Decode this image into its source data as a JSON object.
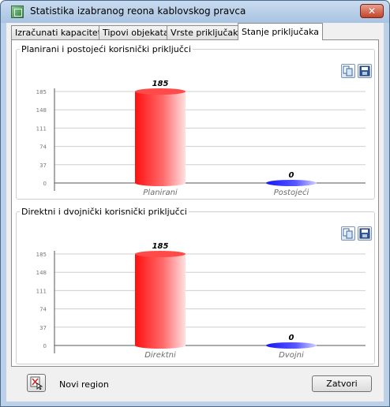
{
  "window": {
    "title": "Statistika izabranog reona kablovskog pravca",
    "close_glyph": "✕"
  },
  "tabs": [
    {
      "label": "Izračunati kapacitet",
      "active": false
    },
    {
      "label": "Tipovi objekata",
      "active": false
    },
    {
      "label": "Vrste priključaka",
      "active": false
    },
    {
      "label": "Stanje priključaka",
      "active": true
    }
  ],
  "groups": [
    {
      "title": "Planirani i postojeći korisnički priključci",
      "icons": [
        "copy-icon",
        "save-icon"
      ]
    },
    {
      "title": "Direktni i dvojnički korisnički priključci",
      "icons": [
        "copy-icon",
        "save-icon"
      ]
    }
  ],
  "chart_data": [
    {
      "type": "bar",
      "categories": [
        "Planirani",
        "Postojeći"
      ],
      "values": [
        185,
        0
      ],
      "colors": [
        "#ff2a2a",
        "#2b2bff"
      ],
      "yticks": [
        "0",
        "37",
        "74",
        "111",
        "148",
        "185"
      ],
      "ylim": [
        0,
        185
      ],
      "grid": true,
      "title": "",
      "xlabel": "",
      "ylabel": ""
    },
    {
      "type": "bar",
      "categories": [
        "Direktni",
        "Dvojni"
      ],
      "values": [
        185,
        0
      ],
      "colors": [
        "#ff2a2a",
        "#2b2bff"
      ],
      "yticks": [
        "0",
        "37",
        "74",
        "111",
        "148",
        "185"
      ],
      "ylim": [
        0,
        185
      ],
      "grid": true,
      "title": "",
      "xlabel": "",
      "ylabel": ""
    }
  ],
  "footer": {
    "region_label": "Novi region",
    "region_icon": "new-region-icon",
    "close_label": "Zatvori"
  }
}
